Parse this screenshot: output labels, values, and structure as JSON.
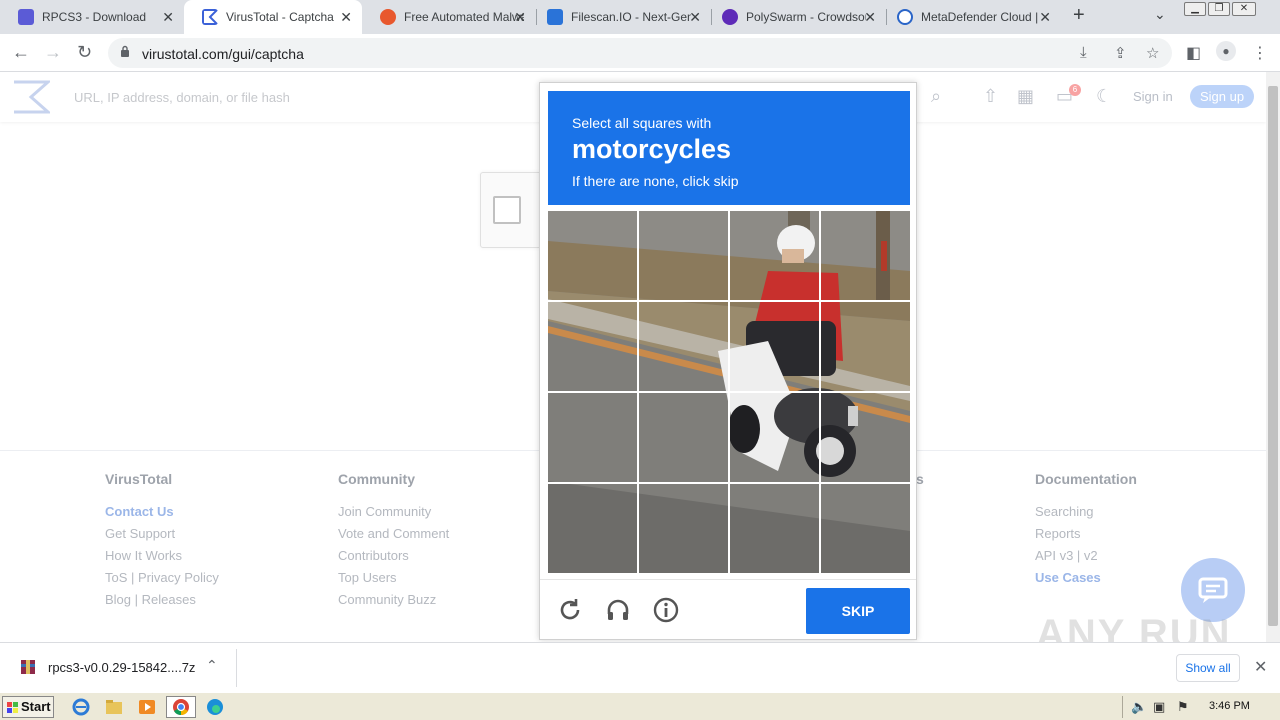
{
  "browser": {
    "tabs": [
      {
        "title": "RPCS3 - Download",
        "color": "#5b5bd6"
      },
      {
        "title": "VirusTotal - Captcha",
        "color": "#3b61d8"
      },
      {
        "title": "Free Automated Malwa",
        "color": "#e8582e"
      },
      {
        "title": "Filescan.IO - Next-Gen",
        "color": "#2a73d8"
      },
      {
        "title": "PolySwarm - Crowdsou",
        "color": "#5e2bb8"
      },
      {
        "title": "MetaDefender Cloud |",
        "color": "#2a65c8"
      }
    ],
    "new_tab": "+",
    "url": "virustotal.com/gui/captcha"
  },
  "vt_header": {
    "search_placeholder": "URL, IP address, domain, or file hash",
    "notifications": "6",
    "sign_in": "Sign in",
    "sign_up": "Sign up"
  },
  "footer": {
    "col1": {
      "head": "VirusTotal",
      "links": [
        "Contact Us",
        "Get Support",
        "How It Works",
        "ToS | Privacy Policy",
        "Blog | Releases"
      ]
    },
    "col2": {
      "head": "Community",
      "links": [
        "Join Community",
        "Vote and Comment",
        "Contributors",
        "Top Users",
        "Community Buzz"
      ]
    },
    "col3_partial": "s",
    "col4": {
      "head": "Documentation",
      "links": [
        "Searching",
        "Reports",
        "API v3 | v2",
        "Use Cases"
      ]
    }
  },
  "captcha": {
    "line1": "Select all squares with",
    "target": "motorcycles",
    "line3": "If there are none, click skip",
    "skip": "SKIP"
  },
  "watermark": "ANY RUN",
  "download": {
    "filename": "rpcs3-v0.0.29-15842....7z",
    "show_all": "Show all"
  },
  "taskbar": {
    "start": "Start",
    "clock": "3:46 PM"
  },
  "colors": {
    "accent": "#1a73e8"
  }
}
